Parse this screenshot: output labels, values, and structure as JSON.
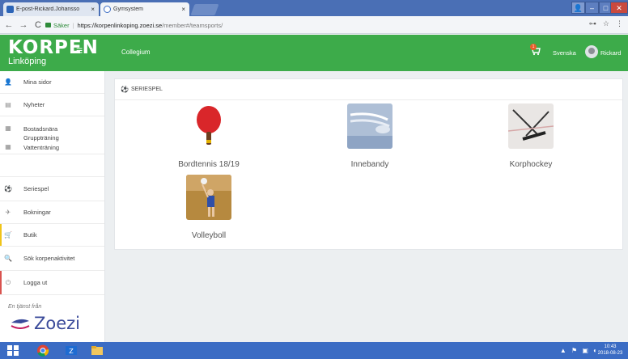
{
  "browser": {
    "tabs": [
      {
        "label": "E-post-Rickard.Johansso",
        "close": "×"
      },
      {
        "label": "Gymsystem",
        "close": "×"
      }
    ],
    "address": {
      "secure_label": "Säker",
      "separator": "|",
      "host": "https://korpenlinkoping.zoezi.se",
      "path": "/member#/teamsports/"
    },
    "nav": {
      "back": "←",
      "forward": "→",
      "reload": "C"
    },
    "right_controls": {
      "key": "⊶",
      "star": "☆",
      "menu": "⋮"
    },
    "window": {
      "minimize": "–",
      "maximize": "□",
      "close": "✕",
      "person": "👤"
    }
  },
  "header": {
    "logo_main": "KORPEN",
    "logo_sub": "Linköping",
    "menu_icon": "≡",
    "org": "Collegium",
    "cart_count": "1",
    "language": "Svenska",
    "user": "Rickard",
    "colors": {
      "brand_green": "#3dab4a",
      "badge": "#e85d2a"
    }
  },
  "sidebar": {
    "items": [
      {
        "label": "Mina sidor",
        "icon": "👤",
        "icon_name": "user-icon"
      },
      {
        "label": "Nyheter",
        "icon": "▤",
        "icon_name": "newspaper-icon"
      },
      {
        "label": "Bostadsnära Gruppträning",
        "icon": "▦",
        "icon_name": "calendar-icon"
      },
      {
        "label": "Vattenträning",
        "icon": "▦",
        "icon_name": "calendar-icon"
      },
      {
        "label": "Seriespel",
        "icon": "⚽",
        "icon_name": "soccer-ball-icon"
      },
      {
        "label": "Bokningar",
        "icon": "✈",
        "icon_name": "plane-icon"
      },
      {
        "label": "Butik",
        "icon": "🛒",
        "icon_name": "cart-icon"
      },
      {
        "label": "Sök korpenaktivitet",
        "icon": "🔍",
        "icon_name": "search-icon"
      },
      {
        "label": "Logga ut",
        "icon": "⏻",
        "icon_name": "power-icon"
      }
    ],
    "footer_text": "En tjänst från",
    "footer_brand": "Zoezi"
  },
  "main": {
    "section_title": "SERIESPEL",
    "sports": [
      {
        "name": "Bordtennis 18/19"
      },
      {
        "name": "Innebandy"
      },
      {
        "name": "Korphockey"
      },
      {
        "name": "Volleyboll"
      }
    ]
  },
  "taskbar": {
    "tray_icons": "▲ ⚑ ▣ ◐",
    "time": "10:43",
    "date": "2018-08-23"
  }
}
